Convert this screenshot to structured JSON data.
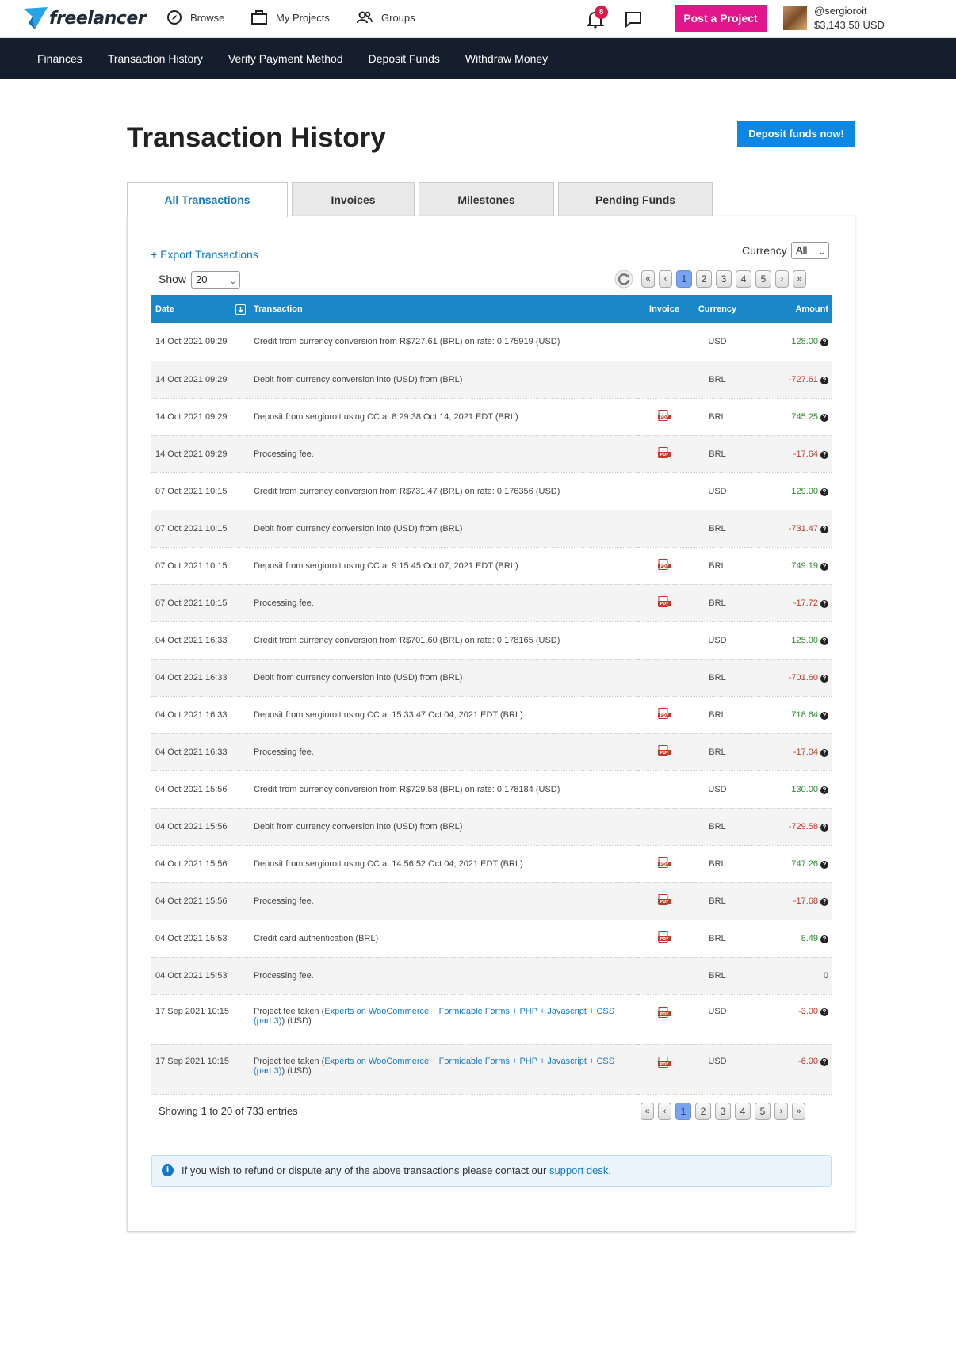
{
  "header": {
    "logo_text": "freelancer",
    "nav": [
      {
        "label": "Browse",
        "icon": "compass-icon"
      },
      {
        "label": "My Projects",
        "icon": "briefcase-icon"
      },
      {
        "label": "Groups",
        "icon": "users-icon"
      }
    ],
    "notification_count": "8",
    "post_project_label": "Post a Project",
    "username": "@sergioroit",
    "balance": "$3,143.50 USD"
  },
  "subnav": [
    "Finances",
    "Transaction History",
    "Verify Payment Method",
    "Deposit Funds",
    "Withdraw Money"
  ],
  "page": {
    "title": "Transaction History",
    "deposit_button": "Deposit funds now!"
  },
  "tabs": [
    "All Transactions",
    "Invoices",
    "Milestones",
    "Pending Funds"
  ],
  "controls": {
    "export_label": "+ Export Transactions",
    "currency_label": "Currency",
    "currency_value": "All",
    "show_label": "Show",
    "show_value": "20"
  },
  "pagination": {
    "first": "«",
    "prev": "‹",
    "next": "›",
    "last": "»",
    "pages": [
      "1",
      "2",
      "3",
      "4",
      "5"
    ],
    "current": "1"
  },
  "table": {
    "headers": {
      "date": "Date",
      "transaction": "Transaction",
      "invoice": "Invoice",
      "currency": "Currency",
      "amount": "Amount"
    },
    "rows": [
      {
        "date": "14 Oct 2021 09:29",
        "text": "Credit from currency conversion from R$727.61 (BRL) on rate: 0.175919 (USD)",
        "invoice": false,
        "currency": "USD",
        "amount": "128.00",
        "sign": "pos"
      },
      {
        "date": "14 Oct 2021 09:29",
        "text": "Debit from currency conversion into (USD) from (BRL)",
        "invoice": false,
        "currency": "BRL",
        "amount": "-727.61",
        "sign": "neg"
      },
      {
        "date": "14 Oct 2021 09:29",
        "text": "Deposit from sergioroit using CC at 8:29:38 Oct 14, 2021 EDT (BRL)",
        "invoice": true,
        "currency": "BRL",
        "amount": "745.25",
        "sign": "pos"
      },
      {
        "date": "14 Oct 2021 09:29",
        "text": "Processing fee.",
        "invoice": true,
        "currency": "BRL",
        "amount": "-17.64",
        "sign": "neg"
      },
      {
        "date": "07 Oct 2021 10:15",
        "text": "Credit from currency conversion from R$731.47 (BRL) on rate: 0.176356 (USD)",
        "invoice": false,
        "currency": "USD",
        "amount": "129.00",
        "sign": "pos"
      },
      {
        "date": "07 Oct 2021 10:15",
        "text": "Debit from currency conversion into (USD) from (BRL)",
        "invoice": false,
        "currency": "BRL",
        "amount": "-731.47",
        "sign": "neg"
      },
      {
        "date": "07 Oct 2021 10:15",
        "text": "Deposit from sergioroit using CC at 9:15:45 Oct 07, 2021 EDT (BRL)",
        "invoice": true,
        "currency": "BRL",
        "amount": "749.19",
        "sign": "pos"
      },
      {
        "date": "07 Oct 2021 10:15",
        "text": "Processing fee.",
        "invoice": true,
        "currency": "BRL",
        "amount": "-17.72",
        "sign": "neg"
      },
      {
        "date": "04 Oct 2021 16:33",
        "text": "Credit from currency conversion from R$701.60 (BRL) on rate: 0.178165 (USD)",
        "invoice": false,
        "currency": "USD",
        "amount": "125.00",
        "sign": "pos"
      },
      {
        "date": "04 Oct 2021 16:33",
        "text": "Debit from currency conversion into (USD) from (BRL)",
        "invoice": false,
        "currency": "BRL",
        "amount": "-701.60",
        "sign": "neg"
      },
      {
        "date": "04 Oct 2021 16:33",
        "text": "Deposit from sergioroit using CC at 15:33:47 Oct 04, 2021 EDT (BRL)",
        "invoice": true,
        "currency": "BRL",
        "amount": "718.64",
        "sign": "pos"
      },
      {
        "date": "04 Oct 2021 16:33",
        "text": "Processing fee.",
        "invoice": true,
        "currency": "BRL",
        "amount": "-17.04",
        "sign": "neg"
      },
      {
        "date": "04 Oct 2021 15:56",
        "text": "Credit from currency conversion from R$729.58 (BRL) on rate: 0.178184 (USD)",
        "invoice": false,
        "currency": "USD",
        "amount": "130.00",
        "sign": "pos"
      },
      {
        "date": "04 Oct 2021 15:56",
        "text": "Debit from currency conversion into (USD) from (BRL)",
        "invoice": false,
        "currency": "BRL",
        "amount": "-729.58",
        "sign": "neg"
      },
      {
        "date": "04 Oct 2021 15:56",
        "text": "Deposit from sergioroit using CC at 14:56:52 Oct 04, 2021 EDT (BRL)",
        "invoice": true,
        "currency": "BRL",
        "amount": "747.26",
        "sign": "pos"
      },
      {
        "date": "04 Oct 2021 15:56",
        "text": "Processing fee.",
        "invoice": true,
        "currency": "BRL",
        "amount": "-17.68",
        "sign": "neg"
      },
      {
        "date": "04 Oct 2021 15:53",
        "text": "Credit card authentication (BRL)",
        "invoice": true,
        "currency": "BRL",
        "amount": "8.49",
        "sign": "pos"
      },
      {
        "date": "04 Oct 2021 15:53",
        "text": "Processing fee.",
        "invoice": false,
        "currency": "BRL",
        "amount": "0",
        "sign": "zero"
      },
      {
        "date": "17 Sep 2021 10:15",
        "text": "Project fee taken (",
        "link": "Experts on WooCommerce + Formidable Forms + PHP + Javascript + CSS (part 3)",
        "suffix": ") (USD)",
        "invoice": true,
        "currency": "USD",
        "amount": "-3.00",
        "sign": "neg"
      },
      {
        "date": "17 Sep 2021 10:15",
        "text": "Project fee taken (",
        "link": "Experts on WooCommerce + Formidable Forms + PHP + Javascript + CSS (part 3)",
        "suffix": ") (USD)",
        "invoice": true,
        "currency": "USD",
        "amount": "-6.00",
        "sign": "neg"
      }
    ]
  },
  "footer": {
    "showing": "Showing 1 to 20 of 733 entries",
    "info_text": "If you wish to refund or dispute any of the above transactions please contact our ",
    "info_link": "support desk",
    "info_end": "."
  },
  "colors": {
    "brand_dark": "#151e2d",
    "table_header": "#1a87c9",
    "post_button": "#e0168a",
    "deposit_button": "#0d87e6",
    "positive": "#2e8b2e",
    "negative": "#c0392b"
  }
}
